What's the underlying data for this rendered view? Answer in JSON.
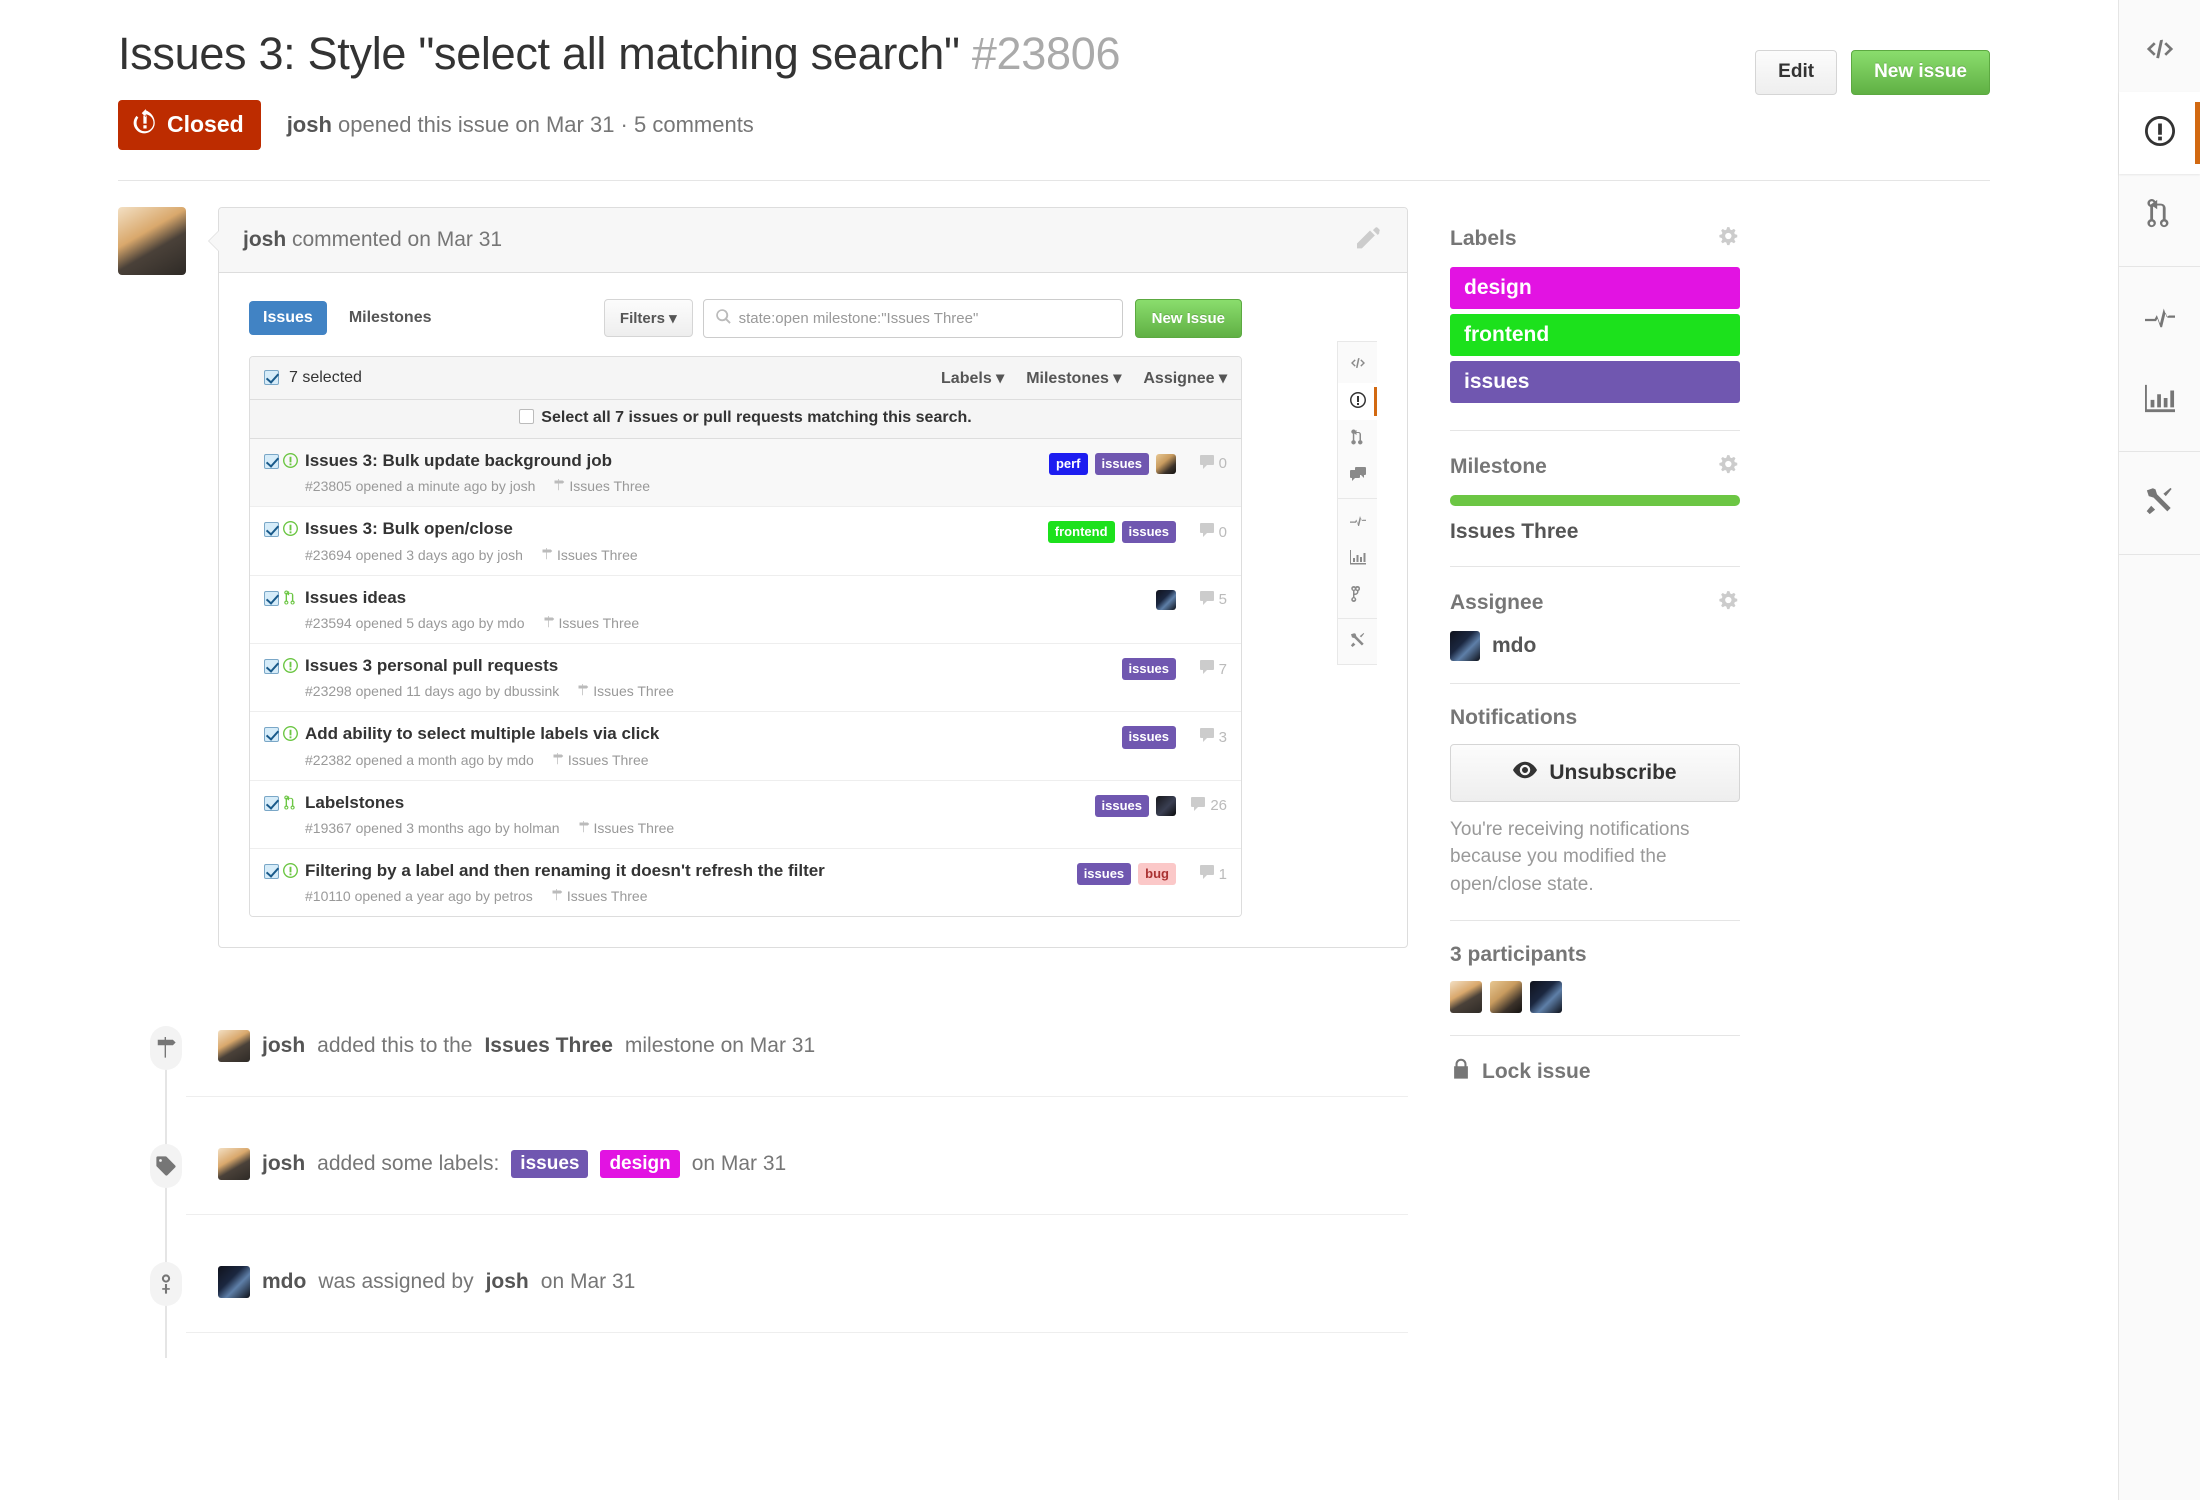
{
  "header": {
    "title": "Issues 3: Style \"select all matching search\"",
    "number": "#23806",
    "edit_label": "Edit",
    "new_issue_label": "New issue",
    "state": "Closed",
    "meta_author": "josh",
    "meta_text": " opened this issue on Mar 31 · 5 comments"
  },
  "comment": {
    "author": "josh",
    "meta": " commented on Mar 31"
  },
  "embedded": {
    "tabs": {
      "issues": "Issues",
      "milestones": "Milestones"
    },
    "filters_label": "Filters",
    "search_value": "state:open milestone:\"Issues Three\"",
    "new_issue_label": "New Issue",
    "selected_count": "7 selected",
    "select_all_text": "Select all 7 issues or pull requests matching this search.",
    "dropdowns": [
      "Labels",
      "Milestones",
      "Assignee"
    ],
    "rows": [
      {
        "title": "Issues 3: Bulk update background job",
        "meta": "#23805 opened a minute ago by josh",
        "milestone": "Issues Three",
        "type": "issue-open",
        "labels": [
          {
            "name": "perf",
            "color": "#1d1df0"
          },
          {
            "name": "issues",
            "color": "#7057b0"
          }
        ],
        "avatar": "holman",
        "comments": "0"
      },
      {
        "title": "Issues 3: Bulk open/close",
        "meta": "#23694 opened 3 days ago by josh",
        "milestone": "Issues Three",
        "type": "issue-open",
        "labels": [
          {
            "name": "frontend",
            "color": "#1ce11c"
          },
          {
            "name": "issues",
            "color": "#7057b0"
          }
        ],
        "avatar": "",
        "comments": "0"
      },
      {
        "title": "Issues ideas",
        "meta": "#23594 opened 5 days ago by mdo",
        "milestone": "Issues Three",
        "type": "pull-request",
        "labels": [],
        "avatar": "mdo",
        "comments": "5"
      },
      {
        "title": "Issues 3 personal pull requests",
        "meta": "#23298 opened 11 days ago by dbussink",
        "milestone": "Issues Three",
        "type": "issue-open",
        "labels": [
          {
            "name": "issues",
            "color": "#7057b0"
          }
        ],
        "avatar": "",
        "comments": "7"
      },
      {
        "title": "Add ability to select multiple labels via click",
        "meta": "#22382 opened a month ago by mdo",
        "milestone": "Issues Three",
        "type": "issue-open",
        "labels": [
          {
            "name": "issues",
            "color": "#7057b0"
          }
        ],
        "avatar": "",
        "comments": "3"
      },
      {
        "title": "Labelstones",
        "meta": "#19367 opened 3 months ago by holman",
        "milestone": "Issues Three",
        "type": "pull-request",
        "labels": [
          {
            "name": "issues",
            "color": "#7057b0"
          }
        ],
        "avatar": "dark",
        "comments": "26"
      },
      {
        "title": "Filtering by a label and then renaming it doesn't refresh the filter",
        "meta": "#10110 opened a year ago by petros",
        "milestone": "Issues Three",
        "type": "issue-open",
        "labels": [
          {
            "name": "issues",
            "color": "#7057b0"
          },
          {
            "name": "bug",
            "color": "#fbc8c8",
            "text": "#a33"
          }
        ],
        "avatar": "",
        "comments": "1"
      }
    ]
  },
  "timeline": [
    {
      "icon": "milestone-icon",
      "avatar": "josh",
      "actor": "josh",
      "text_before": " added this to the ",
      "strong": "Issues Three",
      "text_after": " milestone on Mar 31",
      "labels": []
    },
    {
      "icon": "tag-icon",
      "avatar": "josh",
      "actor": "josh",
      "text_before": " added some labels: ",
      "strong": "",
      "text_after": " on Mar 31",
      "labels": [
        {
          "name": "issues",
          "color": "#7057b0"
        },
        {
          "name": "design",
          "color": "#e213e2"
        }
      ]
    },
    {
      "icon": "person-icon",
      "avatar": "mdo",
      "actor": "mdo",
      "text_before": " was assigned by ",
      "strong": "josh",
      "text_after": " on Mar 31",
      "labels": []
    }
  ],
  "sidebar": {
    "labels_title": "Labels",
    "labels": [
      {
        "name": "design",
        "color": "#e213e2"
      },
      {
        "name": "frontend",
        "color": "#1ce11c"
      },
      {
        "name": "issues",
        "color": "#7057b0"
      }
    ],
    "milestone_title": "Milestone",
    "milestone_name": "Issues Three",
    "milestone_progress_color": "#6cc644",
    "assignee_title": "Assignee",
    "assignee_name": "mdo",
    "notifications_title": "Notifications",
    "unsubscribe_label": "Unsubscribe",
    "notifications_text": "You're receiving notifications because you modified the open/close state.",
    "participants_title": "3 participants",
    "lock_label": "Lock issue"
  },
  "rail": {
    "items": [
      "code-icon",
      "issue-opened-icon",
      "pull-request-icon",
      "pulse-icon",
      "graph-icon",
      "tools-icon"
    ]
  }
}
